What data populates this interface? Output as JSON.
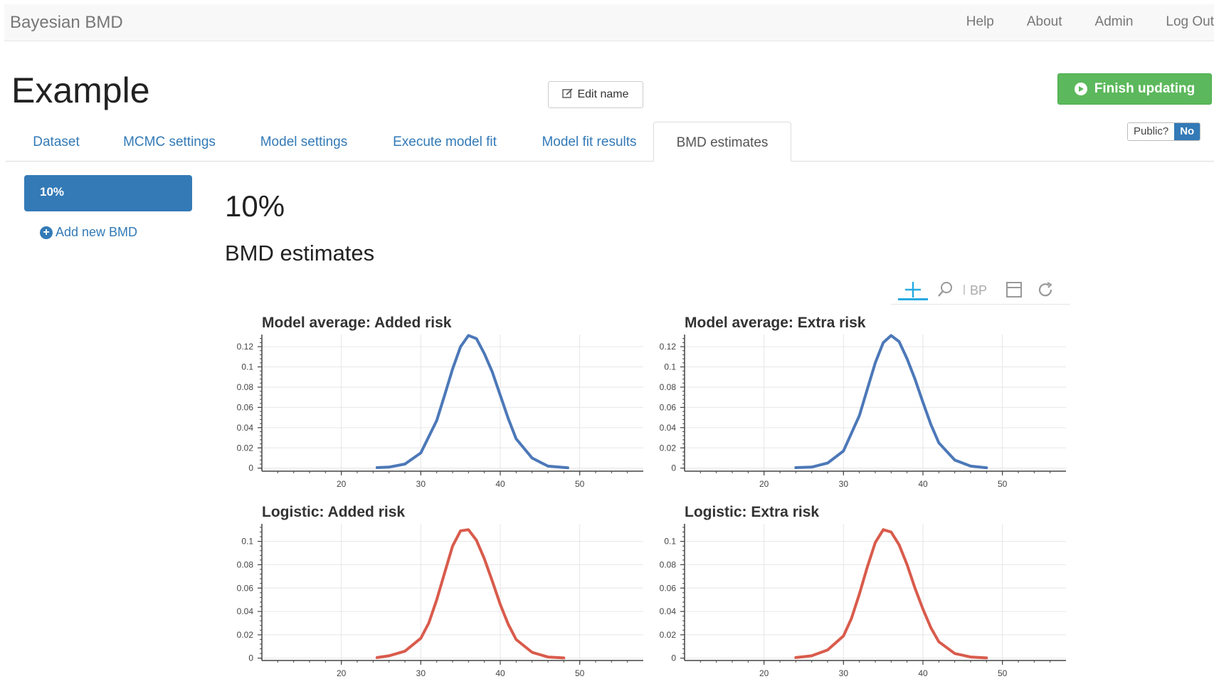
{
  "navbar": {
    "brand": "Bayesian BMD",
    "links": [
      "Help",
      "About",
      "Admin",
      "Log Out"
    ]
  },
  "page": {
    "title": "Example",
    "edit_label": "Edit name",
    "finish_label": "Finish updating",
    "public_label": "Public?",
    "public_value": "No"
  },
  "tabs": [
    "Dataset",
    "MCMC settings",
    "Model settings",
    "Execute model fit",
    "Model fit results",
    "BMD estimates"
  ],
  "active_tab": "BMD estimates",
  "sidebar": {
    "items": [
      "10%"
    ],
    "add_label": "Add new BMD"
  },
  "main": {
    "heading": "10%",
    "subheading": "BMD estimates"
  },
  "toolbar": {
    "tools": [
      "crosshair-icon",
      "zoom-icon",
      "bokeh-logo-icon",
      "save-icon",
      "reset-icon"
    ]
  },
  "colors": {
    "model_average": "#4c78b8",
    "logistic": "#d95b4c",
    "primary": "#337ab7",
    "success": "#5cb85c"
  },
  "chart_data": [
    {
      "type": "line",
      "title": "Model average: Added risk",
      "xlim": [
        10,
        58
      ],
      "ylim": [
        -0.003,
        0.132
      ],
      "xticks": [
        20,
        30,
        40,
        50
      ],
      "yticks": [
        0,
        0.02,
        0.04,
        0.06,
        0.08,
        0.1,
        0.12
      ],
      "ytick_labels": [
        "0",
        "0.02",
        "0.04",
        "0.06",
        "0.08",
        "0.1",
        "0.12"
      ],
      "series": [
        {
          "color": "#4c78b8",
          "x": [
            24.5,
            26,
            28,
            30,
            32,
            33,
            34,
            35,
            36,
            37,
            38,
            39,
            40,
            41,
            42,
            44,
            46,
            48.5
          ],
          "y": [
            0.0005,
            0.001,
            0.004,
            0.015,
            0.047,
            0.072,
            0.098,
            0.12,
            0.131,
            0.128,
            0.113,
            0.095,
            0.072,
            0.049,
            0.029,
            0.01,
            0.002,
            0.0003
          ]
        }
      ]
    },
    {
      "type": "line",
      "title": "Model average: Extra risk",
      "xlim": [
        10,
        58
      ],
      "ylim": [
        -0.003,
        0.132
      ],
      "xticks": [
        20,
        30,
        40,
        50
      ],
      "yticks": [
        0,
        0.02,
        0.04,
        0.06,
        0.08,
        0.1,
        0.12
      ],
      "ytick_labels": [
        "0",
        "0.02",
        "0.04",
        "0.06",
        "0.08",
        "0.1",
        "0.12"
      ],
      "series": [
        {
          "color": "#4c78b8",
          "x": [
            24,
            26,
            28,
            30,
            32,
            33,
            34,
            35,
            36,
            37,
            38,
            39,
            40,
            41,
            42,
            44,
            46,
            48
          ],
          "y": [
            0.0005,
            0.001,
            0.005,
            0.017,
            0.052,
            0.078,
            0.104,
            0.124,
            0.131,
            0.125,
            0.108,
            0.088,
            0.065,
            0.043,
            0.025,
            0.008,
            0.002,
            0.0003
          ]
        }
      ]
    },
    {
      "type": "line",
      "title": "Logistic: Added risk",
      "xlim": [
        10,
        58
      ],
      "ylim": [
        -0.002,
        0.115
      ],
      "xticks": [
        20,
        30,
        40,
        50
      ],
      "yticks": [
        0,
        0.02,
        0.04,
        0.06,
        0.08,
        0.1
      ],
      "ytick_labels": [
        "0",
        "0.02",
        "0.04",
        "0.06",
        "0.08",
        "0.1"
      ],
      "series": [
        {
          "color": "#d95b4c",
          "x": [
            24.5,
            26,
            28,
            30,
            31,
            32,
            33,
            34,
            35,
            36,
            37,
            38,
            39,
            40,
            41,
            42,
            44,
            46,
            48
          ],
          "y": [
            0.0005,
            0.002,
            0.006,
            0.017,
            0.03,
            0.05,
            0.073,
            0.096,
            0.109,
            0.11,
            0.101,
            0.085,
            0.066,
            0.046,
            0.029,
            0.016,
            0.005,
            0.001,
            0.0002
          ]
        }
      ]
    },
    {
      "type": "line",
      "title": "Logistic: Extra risk",
      "xlim": [
        10,
        58
      ],
      "ylim": [
        -0.002,
        0.115
      ],
      "xticks": [
        20,
        30,
        40,
        50
      ],
      "yticks": [
        0,
        0.02,
        0.04,
        0.06,
        0.08,
        0.1
      ],
      "ytick_labels": [
        "0",
        "0.02",
        "0.04",
        "0.06",
        "0.08",
        "0.1"
      ],
      "series": [
        {
          "color": "#d95b4c",
          "x": [
            24,
            26,
            28,
            30,
            31,
            32,
            33,
            34,
            35,
            36,
            37,
            38,
            39,
            40,
            41,
            42,
            44,
            46,
            48
          ],
          "y": [
            0.0005,
            0.002,
            0.007,
            0.019,
            0.034,
            0.055,
            0.078,
            0.099,
            0.11,
            0.108,
            0.097,
            0.08,
            0.06,
            0.042,
            0.026,
            0.014,
            0.004,
            0.001,
            0.0002
          ]
        }
      ]
    }
  ]
}
